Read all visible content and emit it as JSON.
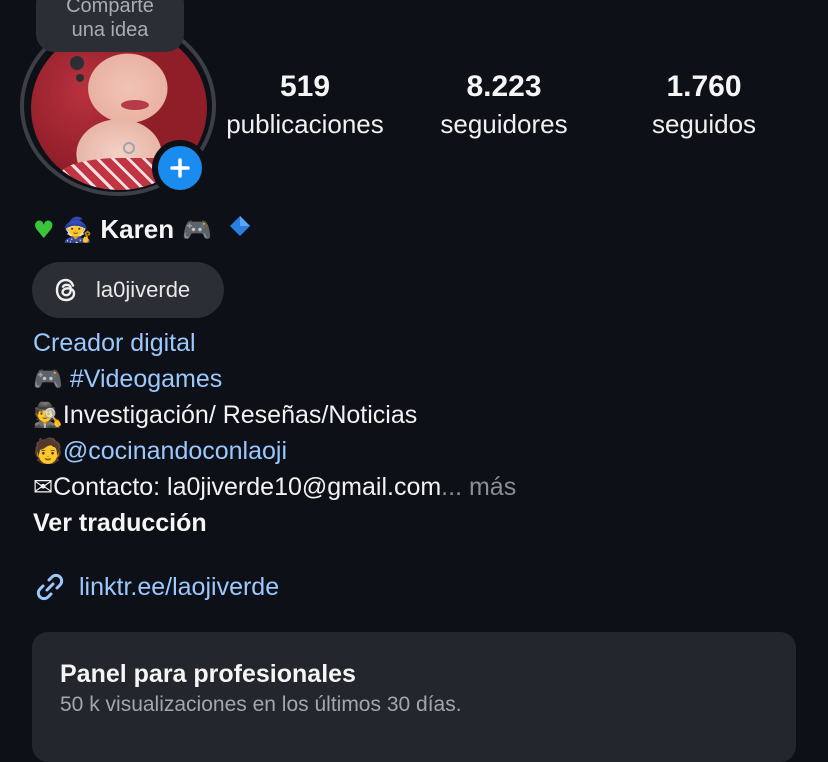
{
  "note": {
    "line1": "Comparte",
    "line2": "una idea"
  },
  "stats": [
    {
      "value": "519",
      "label": "publicaciones"
    },
    {
      "value": "8.223",
      "label": "seguidores"
    },
    {
      "value": "1.760",
      "label": "seguidos"
    }
  ],
  "profile": {
    "name": "Karen",
    "threads_handle": "la0jiverde",
    "category": "Creador digital",
    "bio": {
      "line1_tag": "#Videogames",
      "line2_text": "Investigación/ Reseñas/Noticias",
      "line3_mention": "@cocinandoconlaoji",
      "line4_text": "Contacto: la0jiverde10@gmail.com",
      "more_ellipsis": "...",
      "more": "más"
    },
    "translate": "Ver traducción",
    "link": "linktr.ee/laojiverde"
  },
  "pro_panel": {
    "title": "Panel para profesionales",
    "subtitle": "50 k visualizaciones en los últimos 30 días."
  },
  "icons": {
    "add_story": "plus-icon",
    "threads": "threads-icon",
    "link": "link-icon"
  },
  "colors": {
    "accent_blue": "#1a8cf0",
    "link_blue": "#9bc8ff",
    "background": "#0d1016"
  }
}
